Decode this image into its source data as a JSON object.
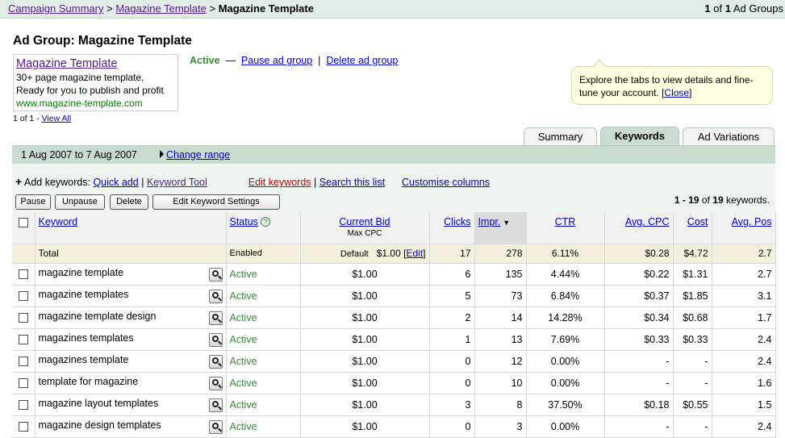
{
  "breadcrumb": {
    "campaign_summary": "Campaign Summary",
    "sep": ">",
    "campaign": "Magazine Template",
    "current": "Magazine Template",
    "count_current": "1",
    "count_of": "of",
    "count_total": "1",
    "count_label": "Ad Groups"
  },
  "adgroup": {
    "title": "Ad Group: Magazine Template",
    "status": "Active",
    "dash": "—",
    "pause_link": "Pause ad group",
    "delete_link": "Delete ad group",
    "pipe": "|"
  },
  "ad": {
    "headline": "Magazine Template",
    "line1": "30+ page magazine template,",
    "line2": "Ready for you to publish and profit",
    "url": "www.magazine-template.com",
    "count": "1 of 1 -",
    "view_all": "View All"
  },
  "tooltip": {
    "text": "Explore the tabs to view details and fine-tune your account. [",
    "close": "Close",
    "end": "]"
  },
  "tabs": [
    {
      "label": "Summary"
    },
    {
      "label": "Keywords"
    },
    {
      "label": "Ad Variations"
    }
  ],
  "daterange": {
    "label": "1 Aug 2007 to 7 Aug 2007",
    "change": "Change range"
  },
  "actions": {
    "plus": "+",
    "add_label": "Add keywords:",
    "quick_add": "Quick add",
    "pipe": "|",
    "keyword_tool": "Keyword Tool",
    "edit_keywords": "Edit keywords",
    "search_list": "Search this list",
    "customise": "Customise columns",
    "buttons": {
      "pause": "Pause",
      "unpause": "Unpause",
      "delete": "Delete",
      "edit_settings": "Edit Keyword Settings"
    },
    "count_range": "1 - 19",
    "count_of": "of",
    "count_total": "19",
    "count_label": "keywords."
  },
  "table": {
    "headers": {
      "keyword": "Keyword",
      "status": "Status",
      "bid": "Current Bid",
      "bid_sub": "Max CPC",
      "clicks": "Clicks",
      "impr": "Impr.",
      "ctr": "CTR",
      "cpc": "Avg. CPC",
      "cost": "Cost",
      "pos": "Avg. Pos"
    },
    "sort_indicator": "▼",
    "help_glyph": "?",
    "total": {
      "label": "Total",
      "status": "Enabled",
      "default": "Default",
      "bid": "$1.00",
      "edit_open": "[",
      "edit": "Edit",
      "edit_close": "]",
      "clicks": "17",
      "impr": "278",
      "ctr": "6.11%",
      "cpc": "$0.28",
      "cost": "$4.72",
      "pos": "2.7"
    },
    "rows": [
      {
        "keyword": "magazine template",
        "status": "Active",
        "bid": "$1.00",
        "clicks": "6",
        "impr": "135",
        "ctr": "4.44%",
        "cpc": "$0.22",
        "cost": "$1.31",
        "pos": "2.7"
      },
      {
        "keyword": "magazine templates",
        "status": "Active",
        "bid": "$1.00",
        "clicks": "5",
        "impr": "73",
        "ctr": "6.84%",
        "cpc": "$0.37",
        "cost": "$1.85",
        "pos": "3.1"
      },
      {
        "keyword": "magazine template design",
        "status": "Active",
        "bid": "$1.00",
        "clicks": "2",
        "impr": "14",
        "ctr": "14.28%",
        "cpc": "$0.34",
        "cost": "$0.68",
        "pos": "1.7"
      },
      {
        "keyword": "magazines templates",
        "status": "Active",
        "bid": "$1.00",
        "clicks": "1",
        "impr": "13",
        "ctr": "7.69%",
        "cpc": "$0.33",
        "cost": "$0.33",
        "pos": "2.4"
      },
      {
        "keyword": "magazines template",
        "status": "Active",
        "bid": "$1.00",
        "clicks": "0",
        "impr": "12",
        "ctr": "0.00%",
        "cpc": "-",
        "cost": "-",
        "pos": "2.4"
      },
      {
        "keyword": "template for magazine",
        "status": "Active",
        "bid": "$1.00",
        "clicks": "0",
        "impr": "10",
        "ctr": "0.00%",
        "cpc": "-",
        "cost": "-",
        "pos": "1.6"
      },
      {
        "keyword": "magazine layout templates",
        "status": "Active",
        "bid": "$1.00",
        "clicks": "3",
        "impr": "8",
        "ctr": "37.50%",
        "cpc": "$0.18",
        "cost": "$0.55",
        "pos": "1.5"
      },
      {
        "keyword": "magazine design templates",
        "status": "Active",
        "bid": "$1.00",
        "clicks": "0",
        "impr": "3",
        "ctr": "0.00%",
        "cpc": "-",
        "cost": "-",
        "pos": "2.4"
      }
    ]
  },
  "colors": {
    "link": "#0000cc",
    "visited": "#551a8b",
    "active_green": "#3a8a3a",
    "header_bar": "#e1ece4",
    "tab_selected": "#c9dccf",
    "alert_red": "#cc0000"
  }
}
